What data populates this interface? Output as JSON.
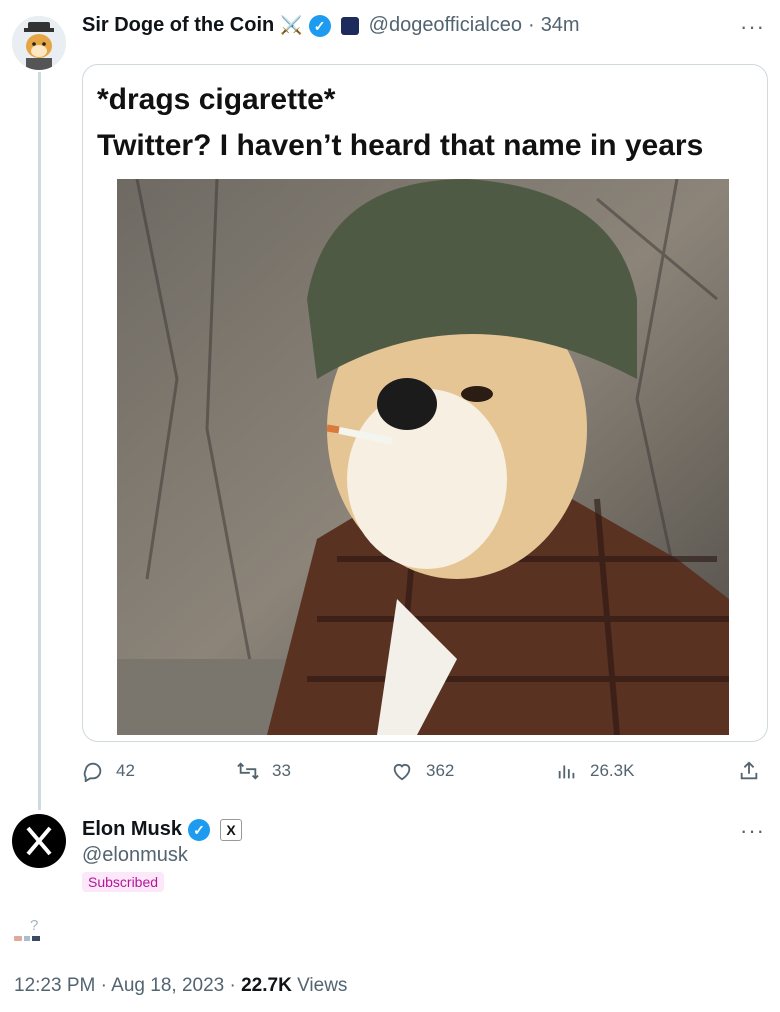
{
  "tweet": {
    "author_name": "Sir Doge of the Coin",
    "author_emoji": "⚔️",
    "handle": "@dogeofficialceo",
    "separator": "·",
    "time_ago": "34m",
    "more": "···",
    "meme": {
      "line1": "*drags cigarette*",
      "line2": "Twitter? I haven’t heard that name in years"
    },
    "actions": {
      "replies": "42",
      "retweets": "33",
      "likes": "362",
      "views": "26.3K"
    }
  },
  "reply": {
    "author_name": "Elon Musk",
    "handle": "@elonmusk",
    "badge": "Subscribed",
    "more": "···",
    "body_glyph": "?",
    "time": "12:23 PM",
    "date": "Aug 18, 2023",
    "separator": "·",
    "views_count": "22.7K",
    "views_label": "Views"
  },
  "colors": {
    "accent": "#1d9bf0",
    "secondary_text": "#536471",
    "subscribed_badge": "#b4169a"
  }
}
